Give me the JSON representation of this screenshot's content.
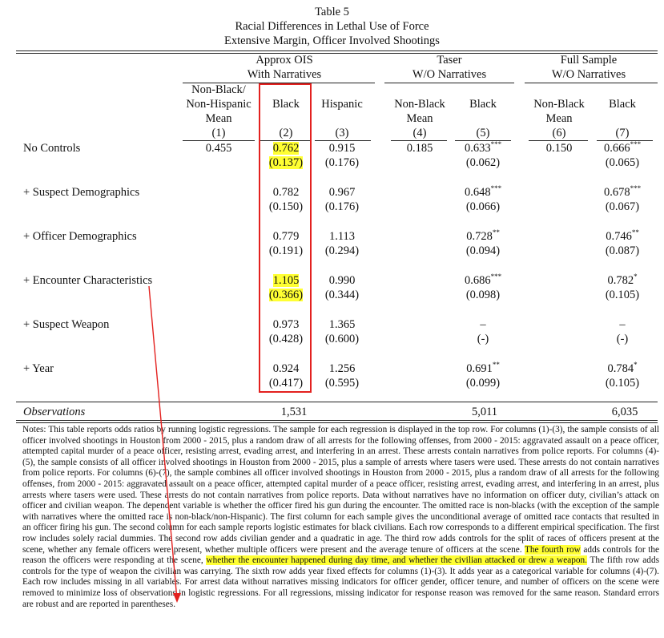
{
  "table": {
    "number": "Table 5",
    "title": "Racial Differences in Lethal Use of Force",
    "subtitle": "Extensive Margin, Officer Involved Shootings",
    "groups": [
      {
        "line1": "Approx OIS",
        "line2": "With Narratives"
      },
      {
        "line1": "Taser",
        "line2": "W/O Narratives"
      },
      {
        "line1": "Full Sample",
        "line2": "W/O Narratives"
      }
    ],
    "columns": [
      {
        "label": "Non-Black/\nNon-Hispanic\nMean",
        "num": "(1)"
      },
      {
        "label": "Black",
        "num": "(2)"
      },
      {
        "label": "Hispanic",
        "num": "(3)"
      },
      {
        "label": "Non-Black\nMean",
        "num": "(4)"
      },
      {
        "label": "Black",
        "num": "(5)"
      },
      {
        "label": "Non-Black\nMean",
        "num": "(6)"
      },
      {
        "label": "Black",
        "num": "(7)"
      }
    ],
    "rows": [
      {
        "label": "No Controls",
        "cells": [
          {
            "v": "0.455"
          },
          {
            "v": "0.762",
            "se": "(0.137)",
            "hl": true
          },
          {
            "v": "0.915",
            "se": "(0.176)"
          },
          {
            "v": "0.185"
          },
          {
            "v": "0.633",
            "stars": "***",
            "se": "(0.062)"
          },
          {
            "v": "0.150"
          },
          {
            "v": "0.666",
            "stars": "***",
            "se": "(0.065)"
          }
        ]
      },
      {
        "label": "+ Suspect Demographics",
        "cells": [
          {},
          {
            "v": "0.782",
            "se": "(0.150)"
          },
          {
            "v": "0.967",
            "se": "(0.176)"
          },
          {},
          {
            "v": "0.648",
            "stars": "***",
            "se": "(0.066)"
          },
          {},
          {
            "v": "0.678",
            "stars": "***",
            "se": "(0.067)"
          }
        ]
      },
      {
        "label": "+ Officer Demographics",
        "cells": [
          {},
          {
            "v": "0.779",
            "se": "(0.191)"
          },
          {
            "v": "1.113",
            "se": "(0.294)"
          },
          {},
          {
            "v": "0.728",
            "stars": "**",
            "se": "(0.094)"
          },
          {},
          {
            "v": "0.746",
            "stars": "**",
            "se": "(0.087)"
          }
        ]
      },
      {
        "label": "+ Encounter Characteristics",
        "cells": [
          {},
          {
            "v": "1.105",
            "se": "(0.366)",
            "hl": true
          },
          {
            "v": "0.990",
            "se": "(0.344)"
          },
          {},
          {
            "v": "0.686",
            "stars": "***",
            "se": "(0.098)"
          },
          {},
          {
            "v": "0.782",
            "stars": "*",
            "se": "(0.105)"
          }
        ]
      },
      {
        "label": "+ Suspect Weapon",
        "cells": [
          {},
          {
            "v": "0.973",
            "se": "(0.428)"
          },
          {
            "v": "1.365",
            "se": "(0.600)"
          },
          {},
          {
            "v": "–",
            "se": "(-)"
          },
          {},
          {
            "v": "–",
            "se": "(-)"
          }
        ]
      },
      {
        "label": "+ Year",
        "cells": [
          {},
          {
            "v": "0.924",
            "se": "(0.417)"
          },
          {
            "v": "1.256",
            "se": "(0.595)"
          },
          {},
          {
            "v": "0.691",
            "stars": "**",
            "se": "(0.099)"
          },
          {},
          {
            "v": "0.784",
            "stars": "*",
            "se": "(0.105)"
          }
        ]
      }
    ],
    "observations": {
      "label": "Observations",
      "values": [
        "1,531",
        "5,011",
        "6,035"
      ]
    }
  },
  "notes": {
    "before": "Notes: This table reports odds ratios by running logistic regressions. The sample for each regression is displayed in the top row. For columns (1)-(3), the sample consists of all officer involved shootings in Houston from 2000 - 2015, plus a random draw of all arrests for the following offenses, from 2000 - 2015: aggravated assault on a peace officer, attempted capital murder of a peace officer, resisting arrest, evading arrest, and interfering in an arrest. These arrests contain narratives from police reports. For columns (4)-(5), the sample consists of all officer involved shootings in Houston from 2000 - 2015, plus a sample of arrests where tasers were used. These arrests do not contain narratives from police reports. For columns (6)-(7), the sample combines all officer involved shootings in Houston from 2000 - 2015, plus a random draw of all arrests for the following offenses, from 2000 - 2015: aggravated assault on a peace officer, attempted capital murder of a peace officer, resisting arrest, evading arrest, and interfering in an arrest, plus arrests where tasers were used. These arrests do not contain narratives from police reports. Data without narratives have no information on officer duty, civilian’s attack on officer and civilian weapon. The dependent variable is whether the officer fired his gun during the encounter. The omitted race is non-blacks (with the exception of the sample with narratives where the omitted race is non-black/non-Hispanic). The first column for each sample gives the unconditional average of omitted race contacts that resulted in an officer firing his gun. The second column for each sample reports logistic estimates for black civilians. Each row corresponds to a different empirical specification. The first row includes solely racial dummies. The second row adds civilian gender and a quadratic in age. The third row adds controls for the split of races of officers present at the scene, whether any female officers were present, whether multiple officers were present and the average tenure of officers at the scene. ",
    "hl1": "The fourth row",
    "mid1": " adds controls for the reason the officers were responding at the scene, ",
    "hl2": "whether the encounter happened during day time, and whether the civilian attacked or drew a weapon.",
    "after": " The fifth row adds controls for the type of weapon the civilian was carrying. The sixth row adds year fixed effects for columns (1)-(3). It adds year as a categorical variable for columns (4)-(7). Each row includes missing in all variables. For arrest data without narratives missing indicators for officer gender, officer tenure, and number of officers on the scene were removed to minimize loss of observations in logistic regressions. For all regressions, missing indicator for response reason was removed for the same reason. Standard errors are robust and are reported in parentheses."
  },
  "annotation_color": "#e3211f",
  "highlight_color": "#ffff33"
}
